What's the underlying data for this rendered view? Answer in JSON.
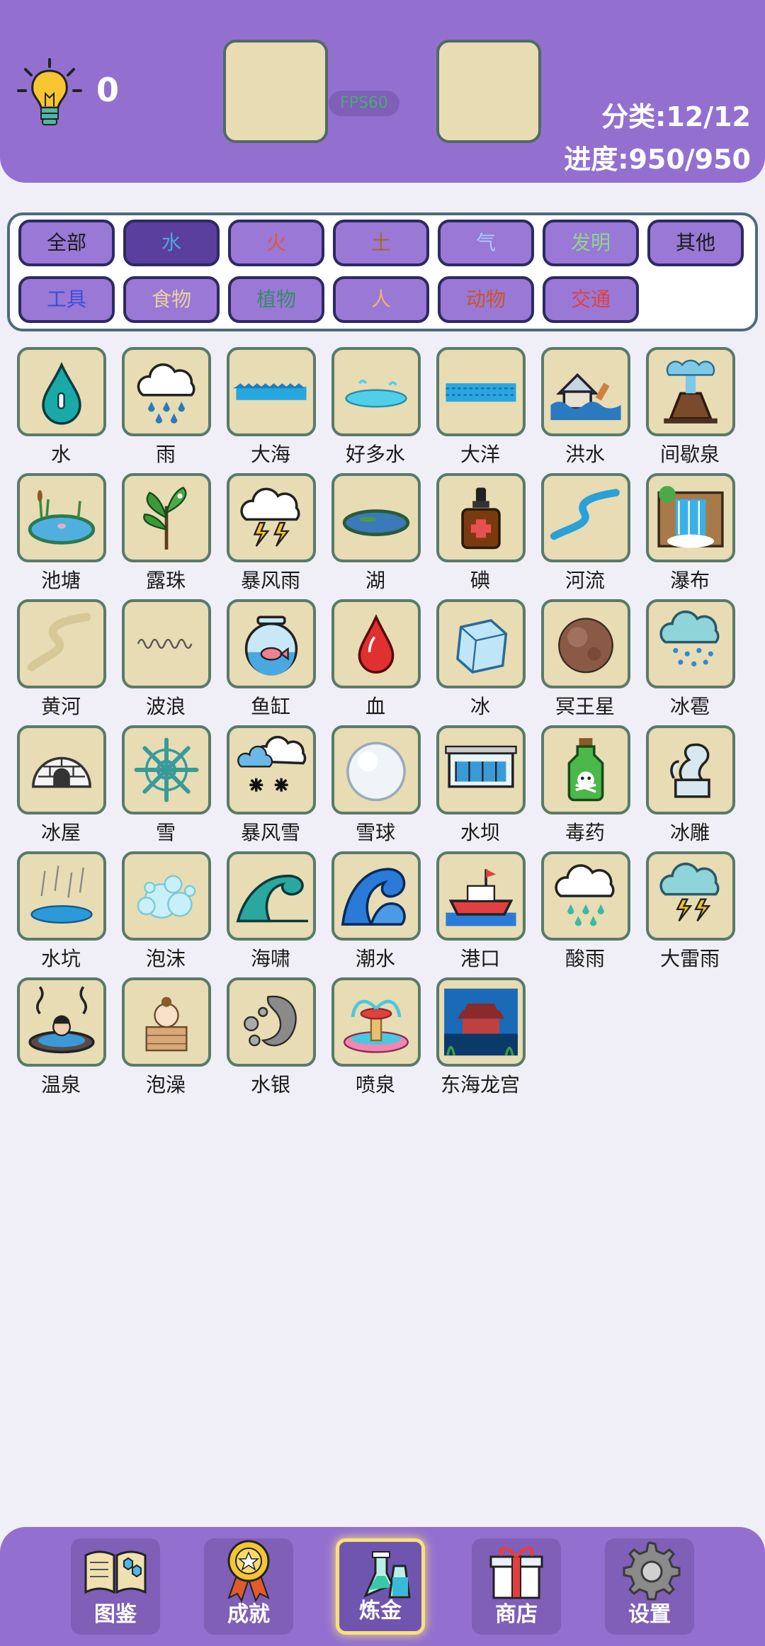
{
  "header": {
    "hint_count": "0",
    "fps": "FPS60",
    "category_stat": "分类:12/12",
    "progress_stat": "进度:950/950"
  },
  "filters": [
    {
      "label": "全部",
      "color": "#1a1a1a",
      "icon": "all"
    },
    {
      "label": "水",
      "color": "#4aa8e0",
      "icon": "water",
      "active": true
    },
    {
      "label": "火",
      "color": "#e0583a"
    },
    {
      "label": "土",
      "color": "#a36a2a"
    },
    {
      "label": "气",
      "color": "#a8c8ff"
    },
    {
      "label": "发明",
      "color": "#8fd38f"
    },
    {
      "label": "其他",
      "color": "#1a1a1a"
    },
    {
      "label": "工具",
      "color": "#3b4fd6"
    },
    {
      "label": "食物",
      "color": "#e8d0a0"
    },
    {
      "label": "植物",
      "color": "#3a8a6a"
    },
    {
      "label": "人",
      "color": "#f0b070"
    },
    {
      "label": "动物",
      "color": "#c7562a"
    },
    {
      "label": "交通",
      "color": "#e04040"
    }
  ],
  "elements": [
    {
      "name": "水",
      "icon": "droplet-icon"
    },
    {
      "name": "雨",
      "icon": "rain-cloud-icon"
    },
    {
      "name": "大海",
      "icon": "sea-icon"
    },
    {
      "name": "好多水",
      "icon": "puddle-icon"
    },
    {
      "name": "大洋",
      "icon": "ocean-icon"
    },
    {
      "name": "洪水",
      "icon": "flood-icon"
    },
    {
      "name": "间歇泉",
      "icon": "geyser-icon"
    },
    {
      "name": "池塘",
      "icon": "pond-icon"
    },
    {
      "name": "露珠",
      "icon": "dew-plant-icon"
    },
    {
      "name": "暴风雨",
      "icon": "storm-icon"
    },
    {
      "name": "湖",
      "icon": "lake-icon"
    },
    {
      "name": "碘",
      "icon": "iodine-bottle-icon"
    },
    {
      "name": "河流",
      "icon": "river-icon"
    },
    {
      "name": "瀑布",
      "icon": "waterfall-icon"
    },
    {
      "name": "黄河",
      "icon": "yellow-river-icon"
    },
    {
      "name": "波浪",
      "icon": "wave-line-icon"
    },
    {
      "name": "鱼缸",
      "icon": "fishbowl-icon"
    },
    {
      "name": "血",
      "icon": "blood-drop-icon"
    },
    {
      "name": "冰",
      "icon": "ice-cube-icon"
    },
    {
      "name": "冥王星",
      "icon": "pluto-icon"
    },
    {
      "name": "冰雹",
      "icon": "hail-icon"
    },
    {
      "name": "冰屋",
      "icon": "igloo-icon"
    },
    {
      "name": "雪",
      "icon": "snowflake-icon"
    },
    {
      "name": "暴风雪",
      "icon": "blizzard-icon"
    },
    {
      "name": "雪球",
      "icon": "snowball-icon"
    },
    {
      "name": "水坝",
      "icon": "dam-icon"
    },
    {
      "name": "毒药",
      "icon": "poison-bottle-icon"
    },
    {
      "name": "冰雕",
      "icon": "ice-sculpture-icon"
    },
    {
      "name": "水坑",
      "icon": "rain-puddle-icon"
    },
    {
      "name": "泡沫",
      "icon": "bubbles-icon"
    },
    {
      "name": "海啸",
      "icon": "tsunami-icon"
    },
    {
      "name": "潮水",
      "icon": "tide-icon"
    },
    {
      "name": "港口",
      "icon": "harbor-ship-icon"
    },
    {
      "name": "酸雨",
      "icon": "acid-rain-icon"
    },
    {
      "name": "大雷雨",
      "icon": "thunderstorm-icon"
    },
    {
      "name": "温泉",
      "icon": "hot-spring-icon"
    },
    {
      "name": "泡澡",
      "icon": "bath-icon"
    },
    {
      "name": "水银",
      "icon": "mercury-icon"
    },
    {
      "name": "喷泉",
      "icon": "fountain-icon"
    },
    {
      "name": "东海龙宫",
      "icon": "dragon-palace-icon"
    }
  ],
  "nav": [
    {
      "label": "图鉴",
      "icon": "book-icon"
    },
    {
      "label": "成就",
      "icon": "medal-icon"
    },
    {
      "label": "炼金",
      "icon": "flask-icon",
      "active": true
    },
    {
      "label": "商店",
      "icon": "gift-icon"
    },
    {
      "label": "设置",
      "icon": "gear-icon"
    }
  ]
}
